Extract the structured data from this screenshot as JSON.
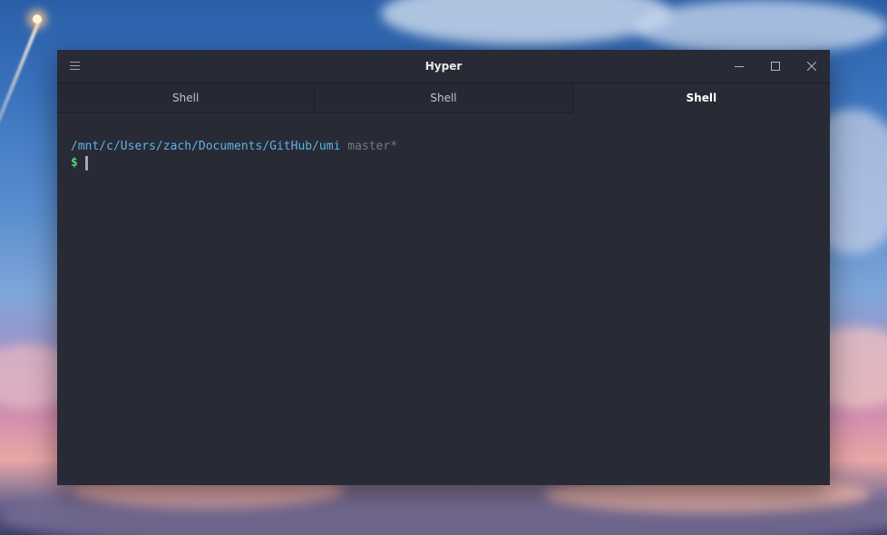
{
  "window": {
    "title": "Hyper"
  },
  "tabs": [
    {
      "label": "Shell",
      "active": false
    },
    {
      "label": "Shell",
      "active": false
    },
    {
      "label": "Shell",
      "active": true
    }
  ],
  "terminal": {
    "cwd": "/mnt/c/Users/zach/Documents/GitHub/umi",
    "branch": "master*",
    "prompt": "$"
  },
  "icons": {
    "menu": "hamburger-menu-icon",
    "minimize": "minimize-icon",
    "maximize": "maximize-icon",
    "close": "close-icon"
  },
  "colors": {
    "window_bg": "#282a35",
    "path": "#5fb3e4",
    "branch": "#767986",
    "prompt": "#4fd37a",
    "cursor": "#a7aab3"
  }
}
